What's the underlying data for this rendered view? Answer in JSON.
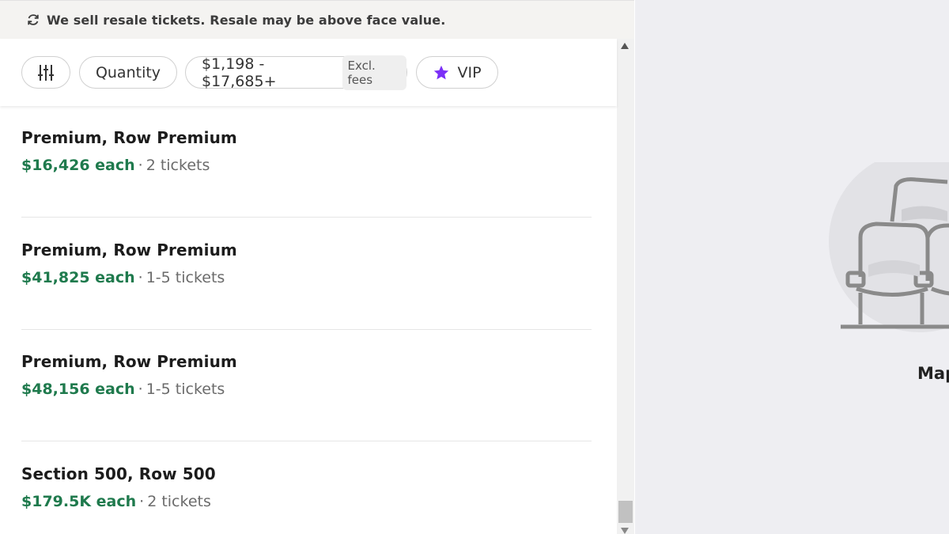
{
  "banner": {
    "text": "We sell resale tickets. Resale may be above face value.",
    "icon": "refresh-icon"
  },
  "filters": {
    "settings_icon": "sliders-icon",
    "quantity_label": "Quantity",
    "price_range": "$1,198 - $17,685+",
    "fees_tag": "Excl. fees",
    "vip_label": "VIP",
    "vip_icon": "star-icon",
    "vip_color": "#7b2ff7"
  },
  "listings": [
    {
      "title": "Premium, Row Premium",
      "price": "$16,426 each",
      "separator": "·",
      "quantity": "2 tickets"
    },
    {
      "title": "Premium, Row Premium",
      "price": "$41,825 each",
      "separator": "·",
      "quantity": "1-5 tickets"
    },
    {
      "title": "Premium, Row Premium",
      "price": "$48,156 each",
      "separator": "·",
      "quantity": "1-5 tickets"
    },
    {
      "title": "Section 500, Row 500",
      "price": "$179.5K each",
      "separator": "·",
      "quantity": "2 tickets"
    }
  ],
  "map": {
    "label": "Map",
    "icon": "seats-icon"
  },
  "colors": {
    "price_green": "#1f7a4d",
    "banner_bg": "#f4f3f1",
    "map_bg": "#eeeef2"
  }
}
